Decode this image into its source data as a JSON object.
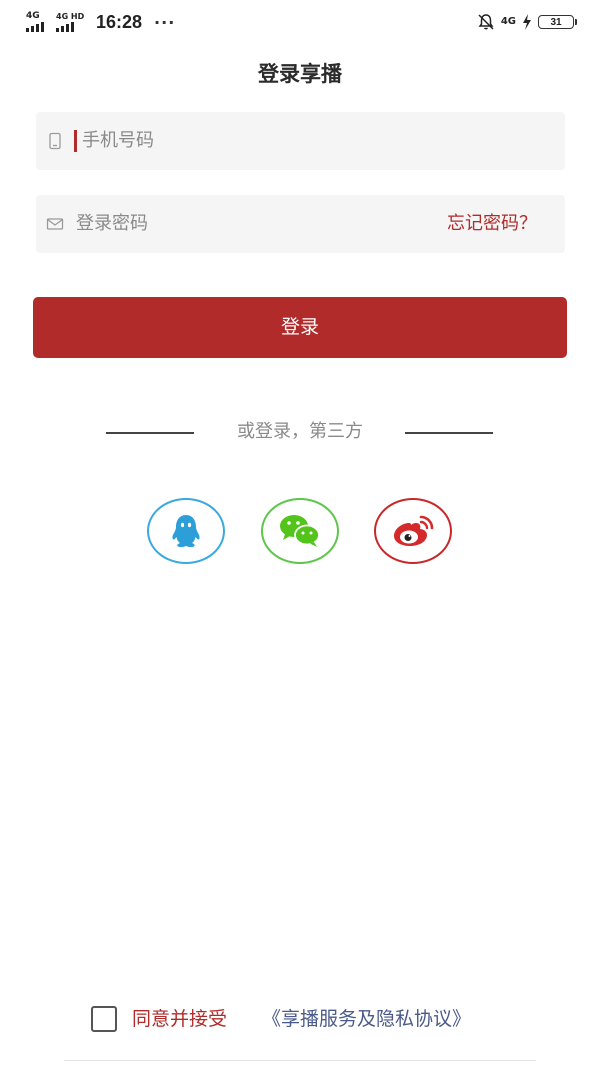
{
  "status_bar": {
    "sim1_network": "4G",
    "sim2_network": "4G HD",
    "time": "16:28",
    "more_indicator": "···",
    "right_network": "4G",
    "battery_level": "31"
  },
  "page": {
    "title": "登录享播"
  },
  "form": {
    "phone_placeholder": "手机号码",
    "password_placeholder": "登录密码",
    "forgot_password": "忘记密码？",
    "login_button": "登录"
  },
  "third_party": {
    "divider_text": "或登录，第三方",
    "providers": [
      {
        "name": "QQ",
        "icon": "qq-penguin-icon",
        "color": "#3aa9e0"
      },
      {
        "name": "WeChat",
        "icon": "wechat-icon",
        "color": "#5cc74a"
      },
      {
        "name": "Weibo",
        "icon": "weibo-icon",
        "color": "#c8282a"
      }
    ]
  },
  "agreement": {
    "agree_text": "同意并接受",
    "link_text": "《享播服务及隐私协议》"
  },
  "colors": {
    "accent": "#b22b2b",
    "field_background": "#f5f5f5",
    "link": "#4a5a8a"
  }
}
